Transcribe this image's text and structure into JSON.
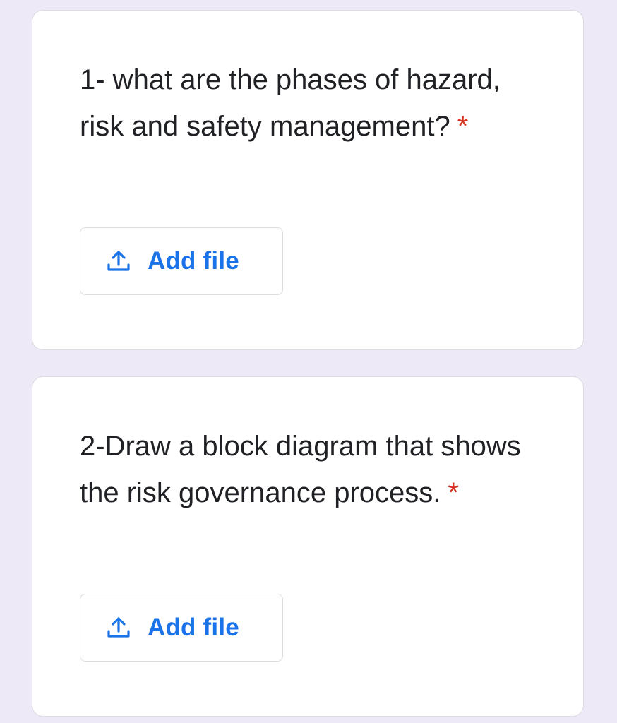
{
  "questions": [
    {
      "text": "1- what are the phases of hazard, risk and safety management?",
      "required_mark": "*",
      "add_file_label": "Add file",
      "icon": "upload-icon"
    },
    {
      "text": "2-Draw a block diagram that shows the risk governance process.",
      "required_mark": "*",
      "add_file_label": "Add file",
      "icon": "upload-icon"
    }
  ],
  "colors": {
    "background": "#ede9f6",
    "card": "#ffffff",
    "accent": "#1a73e8",
    "required": "#d93025",
    "text": "#202124"
  }
}
